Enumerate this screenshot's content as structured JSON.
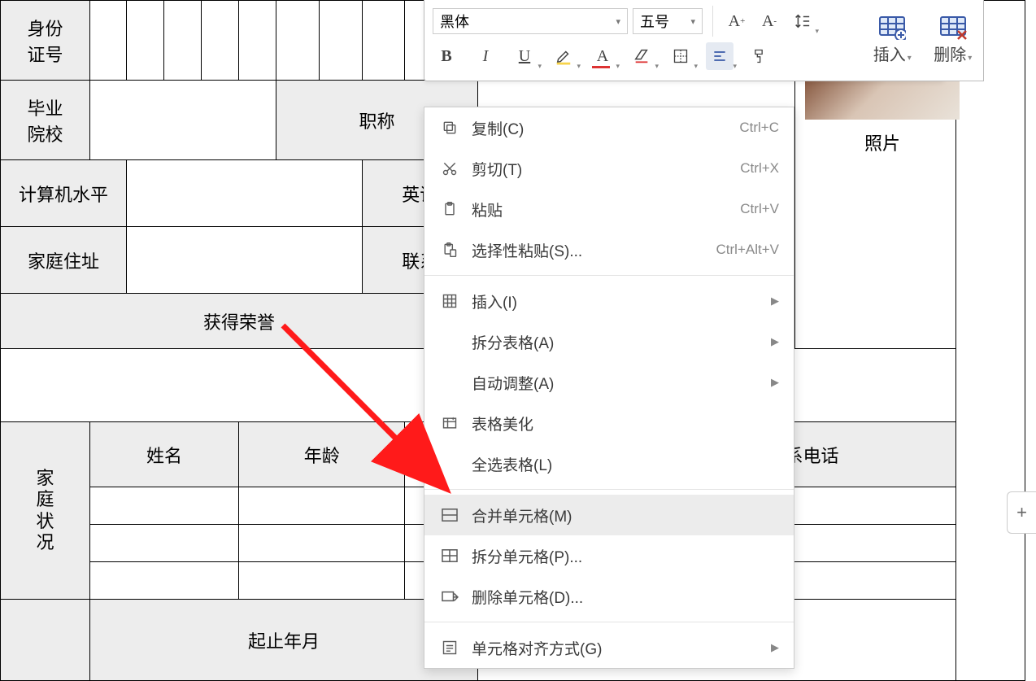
{
  "toolbar": {
    "font_name": "黑体",
    "font_size": "五号",
    "btn_bold": "B",
    "btn_italic": "I",
    "btn_underline": "U",
    "btn_bigger": "A⁺",
    "btn_smaller": "A⁻",
    "insert_label": "插入",
    "delete_label": "删除"
  },
  "context_menu": {
    "copy": {
      "label": "复制(C)",
      "shortcut": "Ctrl+C"
    },
    "cut": {
      "label": "剪切(T)",
      "shortcut": "Ctrl+X"
    },
    "paste": {
      "label": "粘贴",
      "shortcut": "Ctrl+V"
    },
    "paste_special": {
      "label": "选择性粘贴(S)...",
      "shortcut": "Ctrl+Alt+V"
    },
    "insert": {
      "label": "插入(I)"
    },
    "split_table": {
      "label": "拆分表格(A)"
    },
    "auto_fit": {
      "label": "自动调整(A)"
    },
    "beautify": {
      "label": "表格美化"
    },
    "select_all": {
      "label": "全选表格(L)"
    },
    "merge": {
      "label": "合并单元格(M)"
    },
    "split_cell": {
      "label": "拆分单元格(P)..."
    },
    "delete_cell": {
      "label": "删除单元格(D)..."
    },
    "align": {
      "label": "单元格对齐方式(G)"
    }
  },
  "table": {
    "id_no": "身份",
    "id_no2": "证号",
    "grad_school": "毕业",
    "grad_school2": "院校",
    "job_title": "职称",
    "computer_level": "计算机水平",
    "english": "英语",
    "home_address": "家庭住址",
    "contact": "联系",
    "honors": "获得荣誉",
    "family_status": "家\n庭\n状\n况",
    "name": "姓名",
    "age": "年龄",
    "phone": "系电话",
    "photo": "照片",
    "years": "起止年月"
  },
  "side_btn": "+"
}
